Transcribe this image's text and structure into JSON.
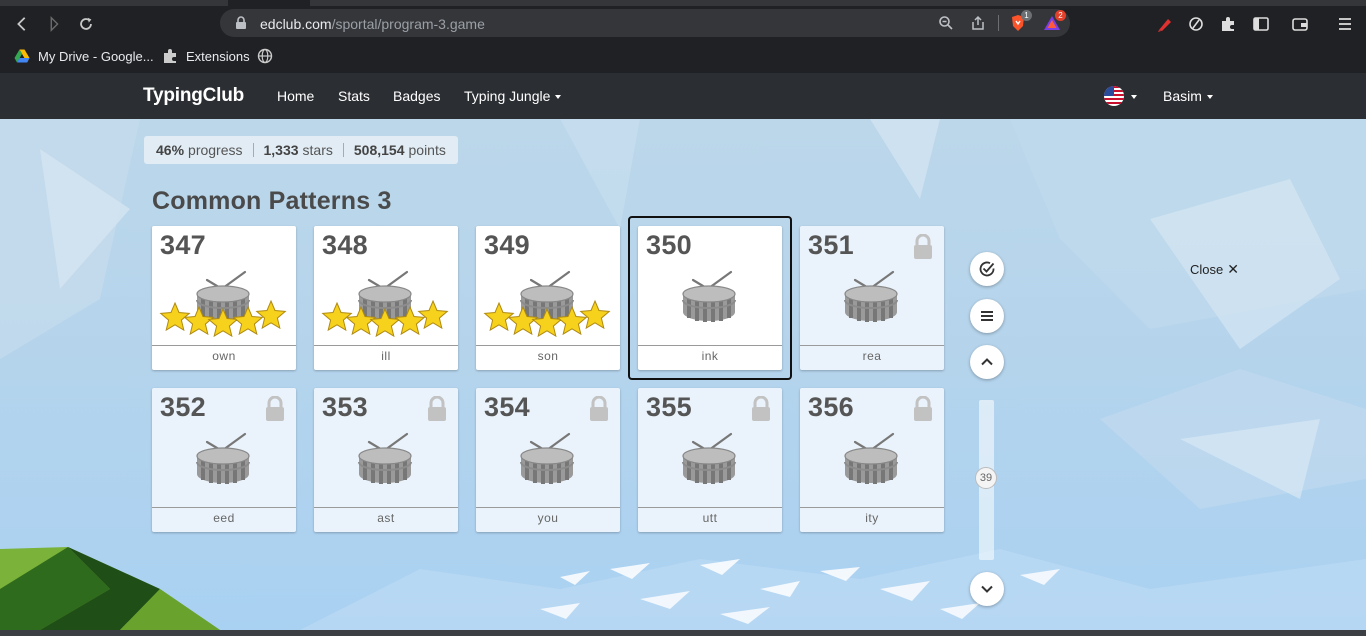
{
  "browser": {
    "url_domain": "edclub.com",
    "url_path": "/sportal/program-3.game",
    "extension_badges": {
      "brave": "1",
      "alert": "2"
    },
    "bookmarks": [
      {
        "label": "My Drive - Google...",
        "icon": "google-drive-icon"
      },
      {
        "label": "Extensions",
        "icon": "puzzle-icon"
      },
      {
        "label": "",
        "icon": "globe-icon"
      }
    ]
  },
  "site": {
    "logo": "TypingClub",
    "nav": [
      "Home",
      "Stats",
      "Badges",
      "Typing Jungle"
    ],
    "user": "Basim"
  },
  "stats": {
    "progress_value": "46%",
    "progress_label": "progress",
    "stars_value": "1,333",
    "stars_label": "stars",
    "points_value": "508,154",
    "points_label": "points"
  },
  "section": {
    "title": "Common Patterns 3"
  },
  "lessons": [
    {
      "number": "347",
      "word": "own",
      "stars": 5,
      "locked": false,
      "selected": false
    },
    {
      "number": "348",
      "word": "ill",
      "stars": 5,
      "locked": false,
      "selected": false
    },
    {
      "number": "349",
      "word": "son",
      "stars": 5,
      "locked": false,
      "selected": false
    },
    {
      "number": "350",
      "word": "ink",
      "stars": 0,
      "locked": false,
      "selected": true
    },
    {
      "number": "351",
      "word": "rea",
      "stars": 0,
      "locked": true,
      "selected": false
    },
    {
      "number": "352",
      "word": "eed",
      "stars": 0,
      "locked": true,
      "selected": false
    },
    {
      "number": "353",
      "word": "ast",
      "stars": 0,
      "locked": true,
      "selected": false
    },
    {
      "number": "354",
      "word": "you",
      "stars": 0,
      "locked": true,
      "selected": false
    },
    {
      "number": "355",
      "word": "utt",
      "stars": 0,
      "locked": true,
      "selected": false
    },
    {
      "number": "356",
      "word": "ity",
      "stars": 0,
      "locked": true,
      "selected": false
    }
  ],
  "sidebar": {
    "scroll_value": "39",
    "close_label": "Close",
    "close_symbol": "✕"
  },
  "colors": {
    "star": "#f6d21c",
    "drum": "#8a8a8a",
    "header": "#2b2e32"
  }
}
